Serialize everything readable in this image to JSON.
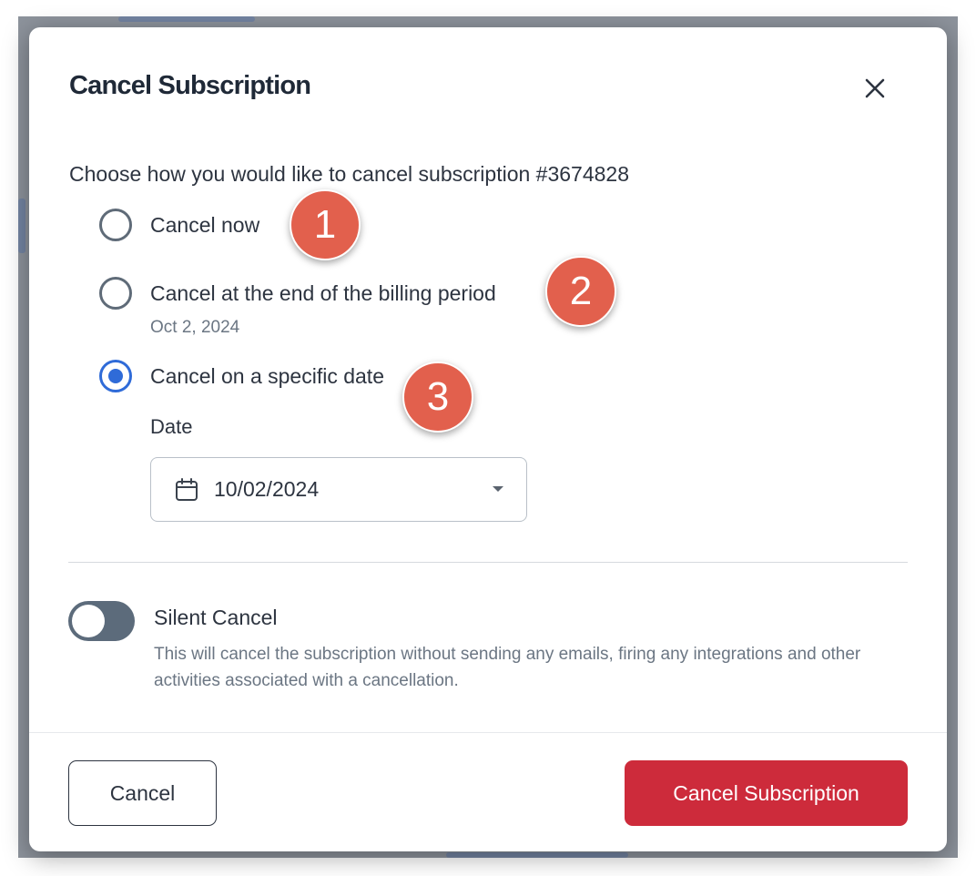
{
  "modal": {
    "title": "Cancel Subscription",
    "close_icon": "close-icon",
    "prompt": "Choose how you would like to cancel subscription #3674828"
  },
  "options": [
    {
      "label": "Cancel now",
      "selected": false
    },
    {
      "label": "Cancel at the end of the billing period",
      "sub": "Oct 2, 2024",
      "selected": false
    },
    {
      "label": "Cancel on a specific date",
      "selected": true
    }
  ],
  "date": {
    "label": "Date",
    "value": "10/02/2024",
    "icon": "calendar-icon"
  },
  "silent": {
    "title": "Silent Cancel",
    "description": "This will cancel the subscription without sending any emails, firing any integrations and other activities associated with a cancellation.",
    "enabled": false
  },
  "footer": {
    "cancel_label": "Cancel",
    "confirm_label": "Cancel Subscription"
  },
  "markers": [
    "1",
    "2",
    "3"
  ],
  "colors": {
    "accent": "#2f6bd8",
    "danger": "#cd2b3b",
    "marker": "#e2604d",
    "toggle_off": "#5c6b7b"
  }
}
